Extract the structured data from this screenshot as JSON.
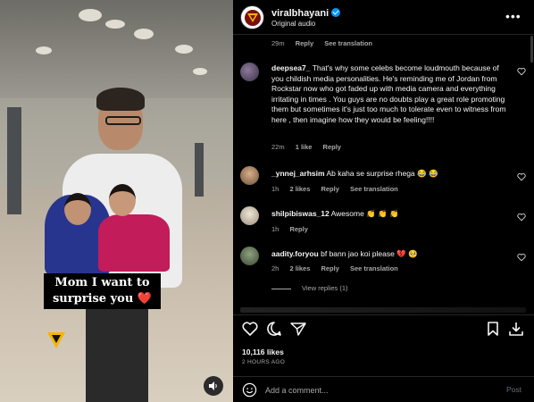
{
  "video": {
    "caption_line1": "Mom I want to",
    "caption_line2": "surprise you",
    "caption_emoji": "❤️",
    "audio_icon": "speaker-icon"
  },
  "post": {
    "username": "viralbhayani",
    "audio": "Original audio",
    "more_icon": "more-icon"
  },
  "top_meta": {
    "time": "29m",
    "reply": "Reply",
    "translate": "See translation"
  },
  "comments": [
    {
      "user": "deepsea7_",
      "text": "That's why some celebs become loudmouth because of you childish media personalities. He's reminding me of Jordan from Rockstar now who got faded up with media camera and everything irritating in times . You guys are no doubts play a great role promoting them but sometimes it's just too much to tolerate even to witness from here , then imagine how they would be feeling!!!!",
      "time": "22m",
      "likes": "1 like",
      "reply": "Reply",
      "translate": ""
    },
    {
      "user": "_ynnej_arhsim",
      "text": "Ab kaha se surprise rhega 😂 😂",
      "time": "1h",
      "likes": "2 likes",
      "reply": "Reply",
      "translate": "See translation"
    },
    {
      "user": "shilpibiswas_12",
      "text": "Awesome 👏 👏 👏",
      "time": "1h",
      "likes": "",
      "reply": "Reply",
      "translate": ""
    },
    {
      "user": "aadity.foryou",
      "text": "bf bann jao koi please 💔 🥺",
      "time": "2h",
      "likes": "2 likes",
      "reply": "Reply",
      "translate": "See translation"
    }
  ],
  "view_replies": "View replies (1)",
  "stats": {
    "likes": "10,116 likes",
    "date": "2 HOURS AGO"
  },
  "composer": {
    "placeholder": "Add a comment...",
    "post_label": "Post"
  },
  "colors": {
    "background": "#000000",
    "text": "#f5f5f5",
    "muted": "#a8a8a8",
    "verified": "#0095f6",
    "post_disabled": "#5f6c7a"
  }
}
